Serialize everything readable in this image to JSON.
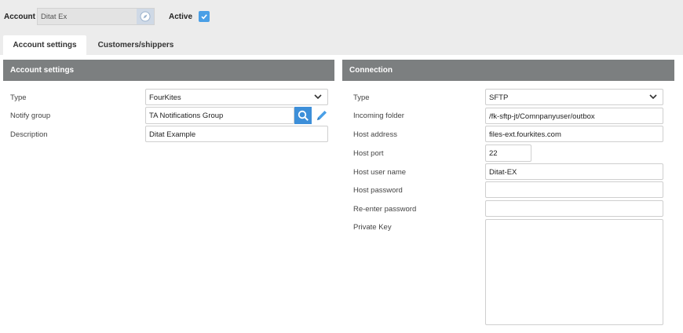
{
  "header": {
    "account_label": "Account",
    "account_value": "Ditat Ex",
    "active_label": "Active",
    "active_checked": true
  },
  "tabs": [
    {
      "label": "Account settings",
      "active": true
    },
    {
      "label": "Customers/shippers",
      "active": false
    }
  ],
  "account_settings": {
    "title": "Account settings",
    "type_label": "Type",
    "type_value": "FourKites",
    "notify_label": "Notify group",
    "notify_value": "TA Notifications Group",
    "description_label": "Description",
    "description_value": "Ditat Example"
  },
  "connection": {
    "title": "Connection",
    "type_label": "Type",
    "type_value": "SFTP",
    "incoming_label": "Incoming folder",
    "incoming_value": "/fk-sftp-jt/Comnpanyuser/outbox",
    "host_address_label": "Host address",
    "host_address_value": "files-ext.fourkites.com",
    "host_port_label": "Host port",
    "host_port_value": "22",
    "host_user_label": "Host user name",
    "host_user_value": "Ditat-EX",
    "host_password_label": "Host password",
    "host_password_value": "",
    "reenter_label": "Re-enter password",
    "reenter_value": "",
    "private_key_label": "Private Key",
    "private_key_value": ""
  },
  "colors": {
    "panel_header": "#7c7f80",
    "accent": "#4a9fe6",
    "topbar": "#ececec"
  }
}
